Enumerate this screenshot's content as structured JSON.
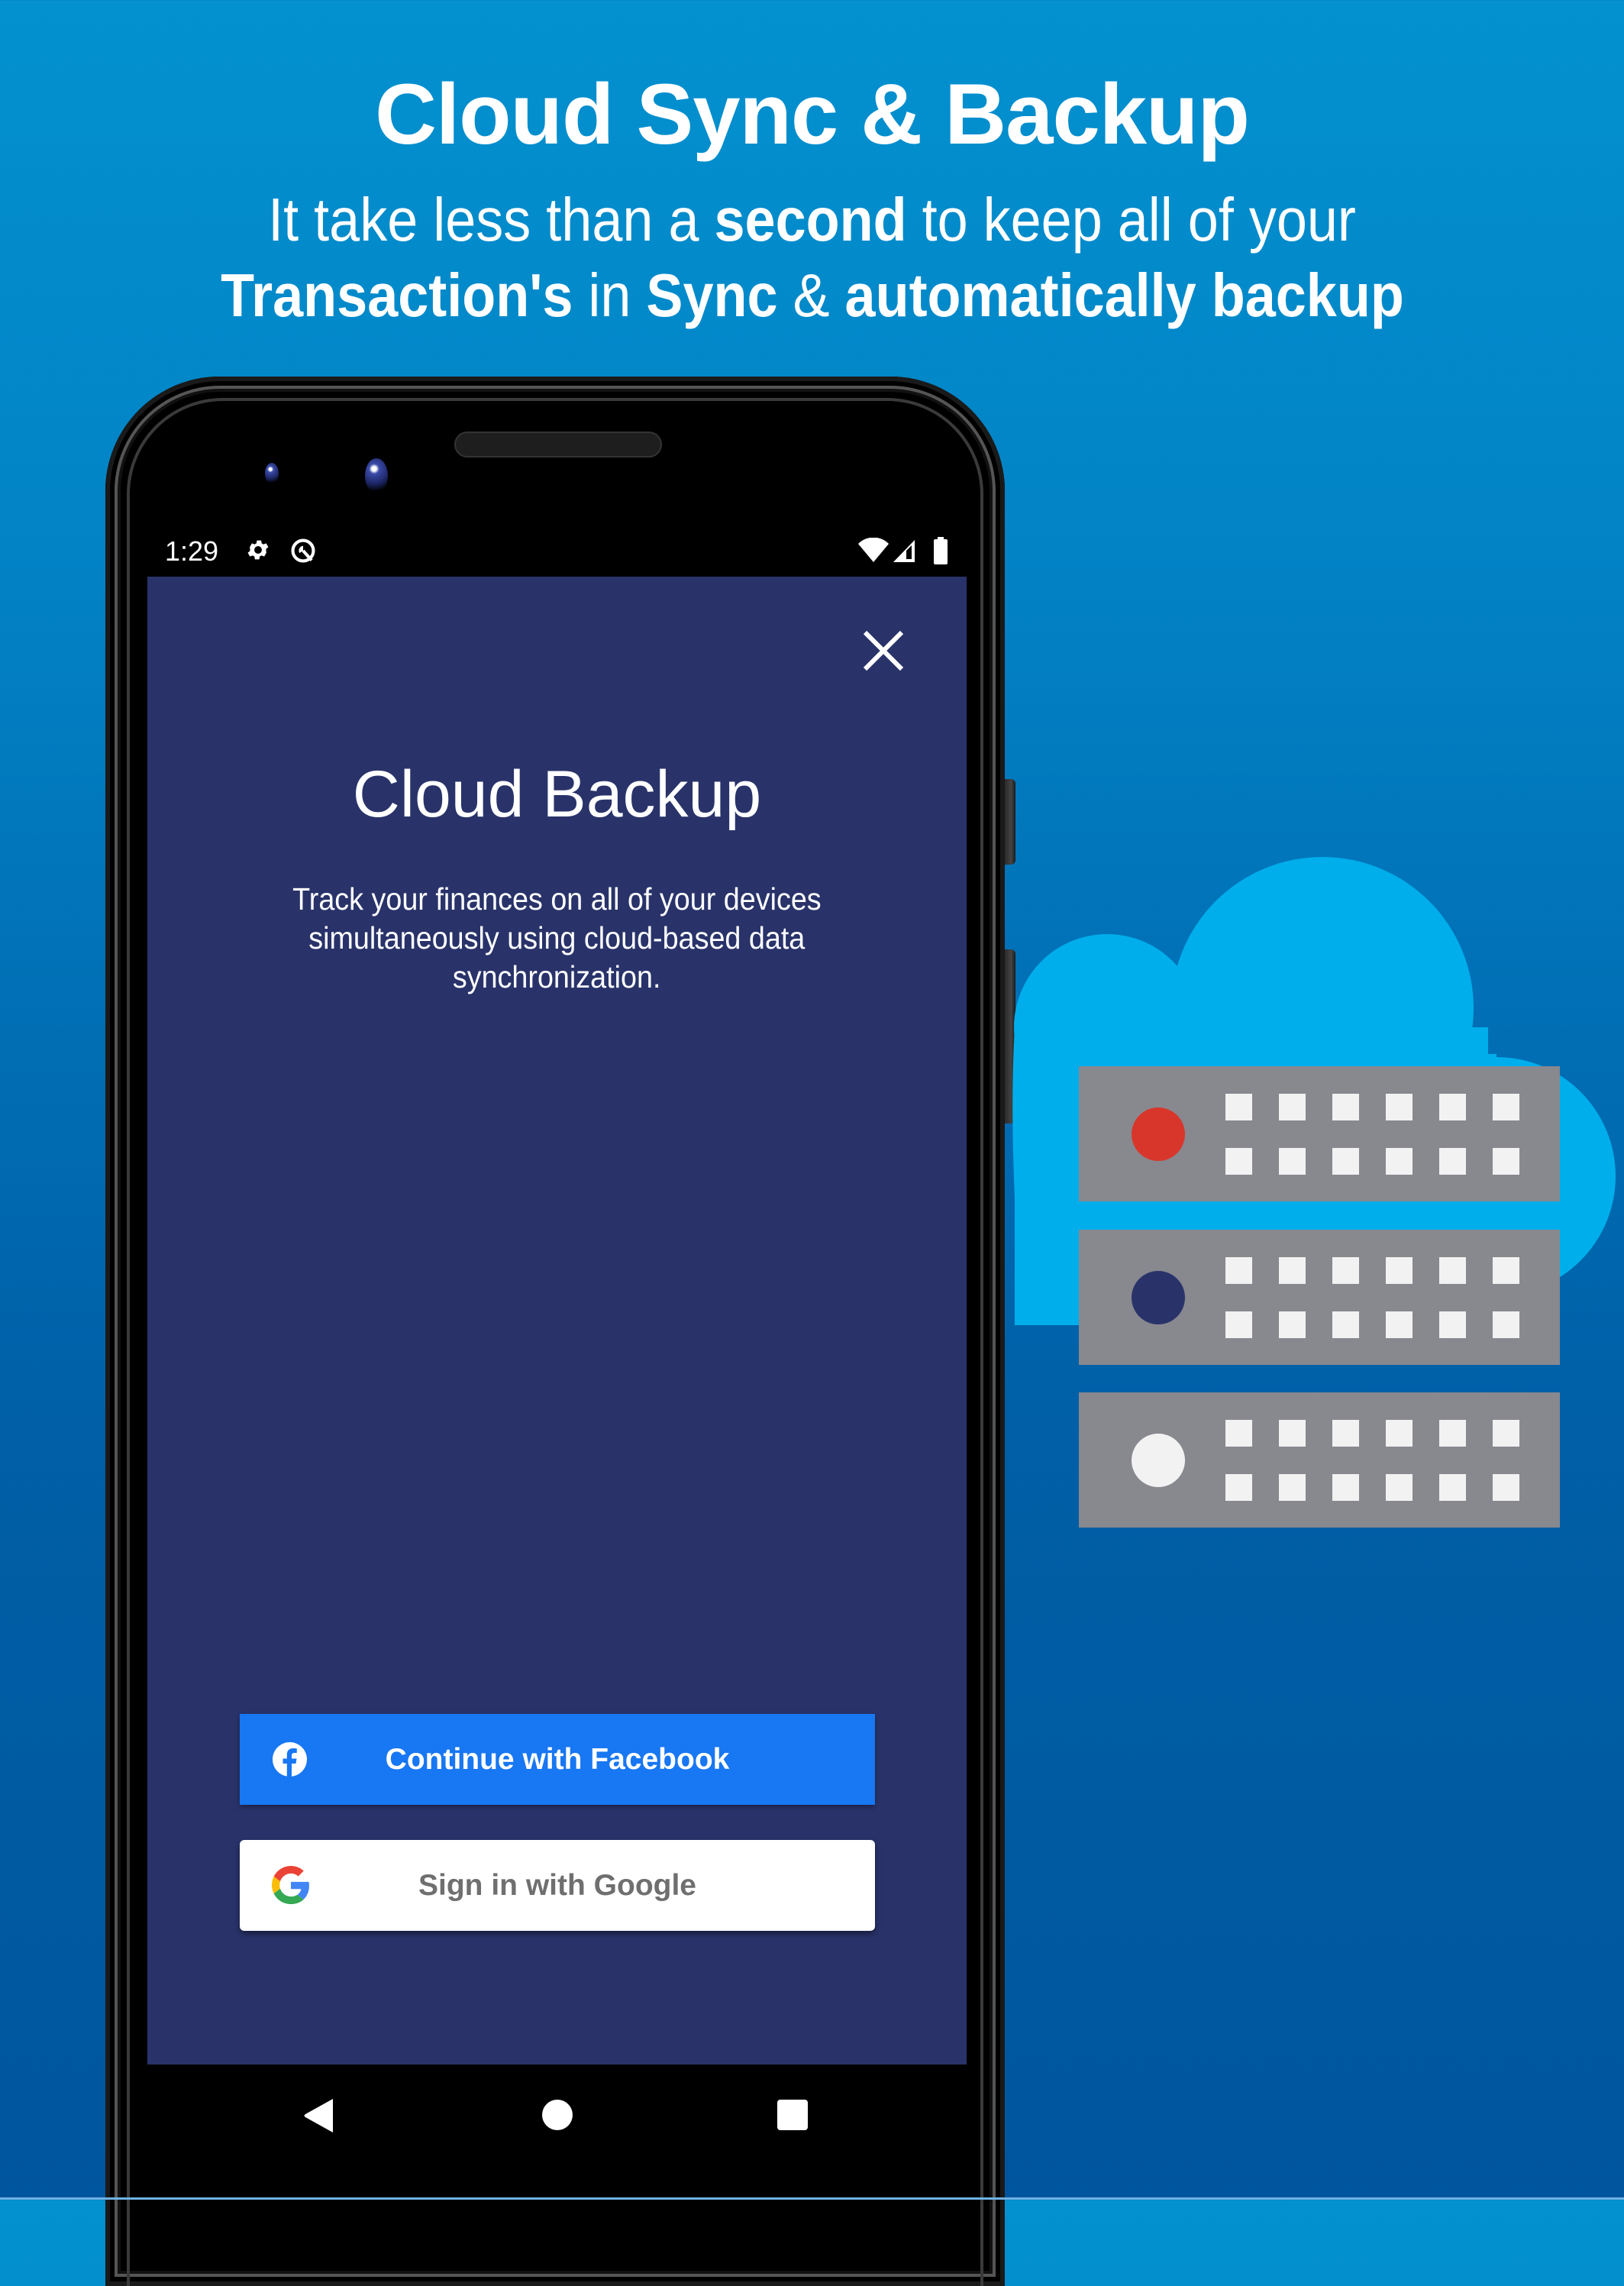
{
  "hero": {
    "title": "Cloud Sync & Backup",
    "subtitle_line1": [
      {
        "text": "It take less than a ",
        "bold": false
      },
      {
        "text": "second",
        "bold": true
      },
      {
        "text": " to keep all of your",
        "bold": false
      }
    ],
    "subtitle_line2": [
      {
        "text": "Transaction's",
        "bold": true
      },
      {
        "text": " in ",
        "bold": false
      },
      {
        "text": "Sync",
        "bold": true
      },
      {
        "text": " & ",
        "bold": false
      },
      {
        "text": "automatically backup",
        "bold": true
      }
    ]
  },
  "status_bar": {
    "time": "1:29",
    "left_icons": [
      "settings-gear-icon",
      "android-q-beta-icon"
    ],
    "right_icons": [
      "wifi-icon",
      "cellular-signal-icon",
      "battery-icon"
    ]
  },
  "screen": {
    "close_icon": "close-icon",
    "title": "Cloud Backup",
    "description_lines": [
      "Track your finances on all of your devices",
      "simultaneously using cloud-based data",
      "synchronization."
    ],
    "buttons": {
      "facebook": {
        "label": "Continue with Facebook",
        "icon": "facebook-icon",
        "color": "#1877f2"
      },
      "google": {
        "label": "Sign in with Google",
        "icon": "google-g-icon",
        "color": "#ffffff"
      }
    },
    "background_color": "#29336a"
  },
  "nav_bar": {
    "items": [
      {
        "name": "back",
        "icon": "back-triangle-icon"
      },
      {
        "name": "home",
        "icon": "home-circle-icon"
      },
      {
        "name": "recents",
        "icon": "recents-square-icon"
      }
    ]
  },
  "illustration": {
    "cloud_color": "#00aeeb",
    "server_color": "#88888f",
    "servers": [
      {
        "led_color": "#d9362b"
      },
      {
        "led_color": "#29336a"
      },
      {
        "led_color": "#f2f2f2"
      }
    ]
  },
  "colors": {
    "background_top": "#0391cf",
    "background_bottom": "#00569e"
  }
}
